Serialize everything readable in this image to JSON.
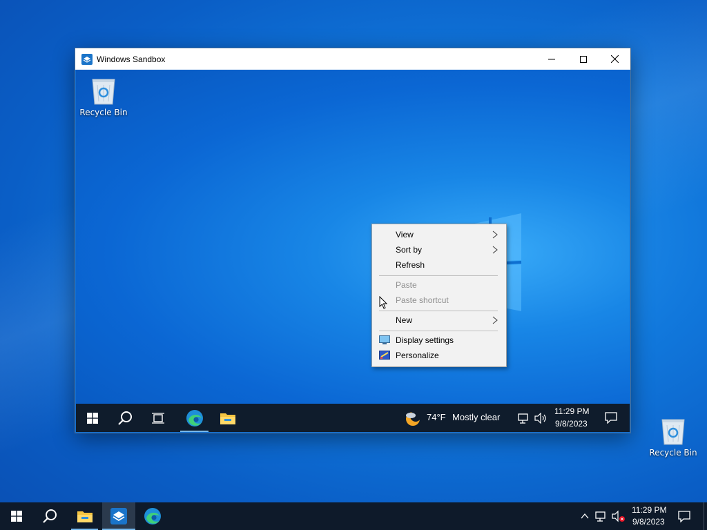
{
  "desktop": {
    "recycle_bin_label": "Recycle Bin"
  },
  "sandbox_window": {
    "title": "Windows Sandbox",
    "minimize_glyph": "—",
    "maximize_glyph": "☐",
    "close_glyph": "✕",
    "desktop": {
      "recycle_bin_label": "Recycle Bin"
    },
    "context_menu": {
      "items": [
        {
          "label": "View",
          "submenu": true,
          "enabled": true
        },
        {
          "label": "Sort by",
          "submenu": true,
          "enabled": true
        },
        {
          "label": "Refresh",
          "submenu": false,
          "enabled": true
        },
        {
          "label": "Paste",
          "submenu": false,
          "enabled": false
        },
        {
          "label": "Paste shortcut",
          "submenu": false,
          "enabled": false
        },
        {
          "label": "New",
          "submenu": true,
          "enabled": true
        },
        {
          "label": "Display settings",
          "submenu": false,
          "enabled": true,
          "icon": "display-icon"
        },
        {
          "label": "Personalize",
          "submenu": false,
          "enabled": true,
          "icon": "personalize-icon"
        }
      ]
    },
    "taskbar": {
      "apps": [
        "start-icon",
        "search-icon",
        "task-view-icon",
        "edge-icon",
        "file-explorer-icon"
      ],
      "weather": {
        "temperature": "74°F",
        "condition": "Mostly clear",
        "icon": "moon-cloud-icon"
      },
      "tray_icons": [
        "network-icon",
        "volume-icon"
      ],
      "time": "11:29 PM",
      "date": "9/8/2023",
      "notification_icon": "action-center-icon"
    }
  },
  "host_taskbar": {
    "apps": [
      "start-icon",
      "search-icon",
      "file-explorer-icon",
      "windows-sandbox-icon",
      "edge-icon"
    ],
    "active_app": "windows-sandbox-icon",
    "tray_icons": [
      "show-hidden-icon",
      "network-icon",
      "volume-muted-icon"
    ],
    "time": "11:29 PM",
    "date": "9/8/2023",
    "notification_icon": "action-center-icon"
  },
  "colors": {
    "accent": "#0078d7",
    "taskbar": "#0f1c2c",
    "menu_bg": "#f2f2f2"
  }
}
